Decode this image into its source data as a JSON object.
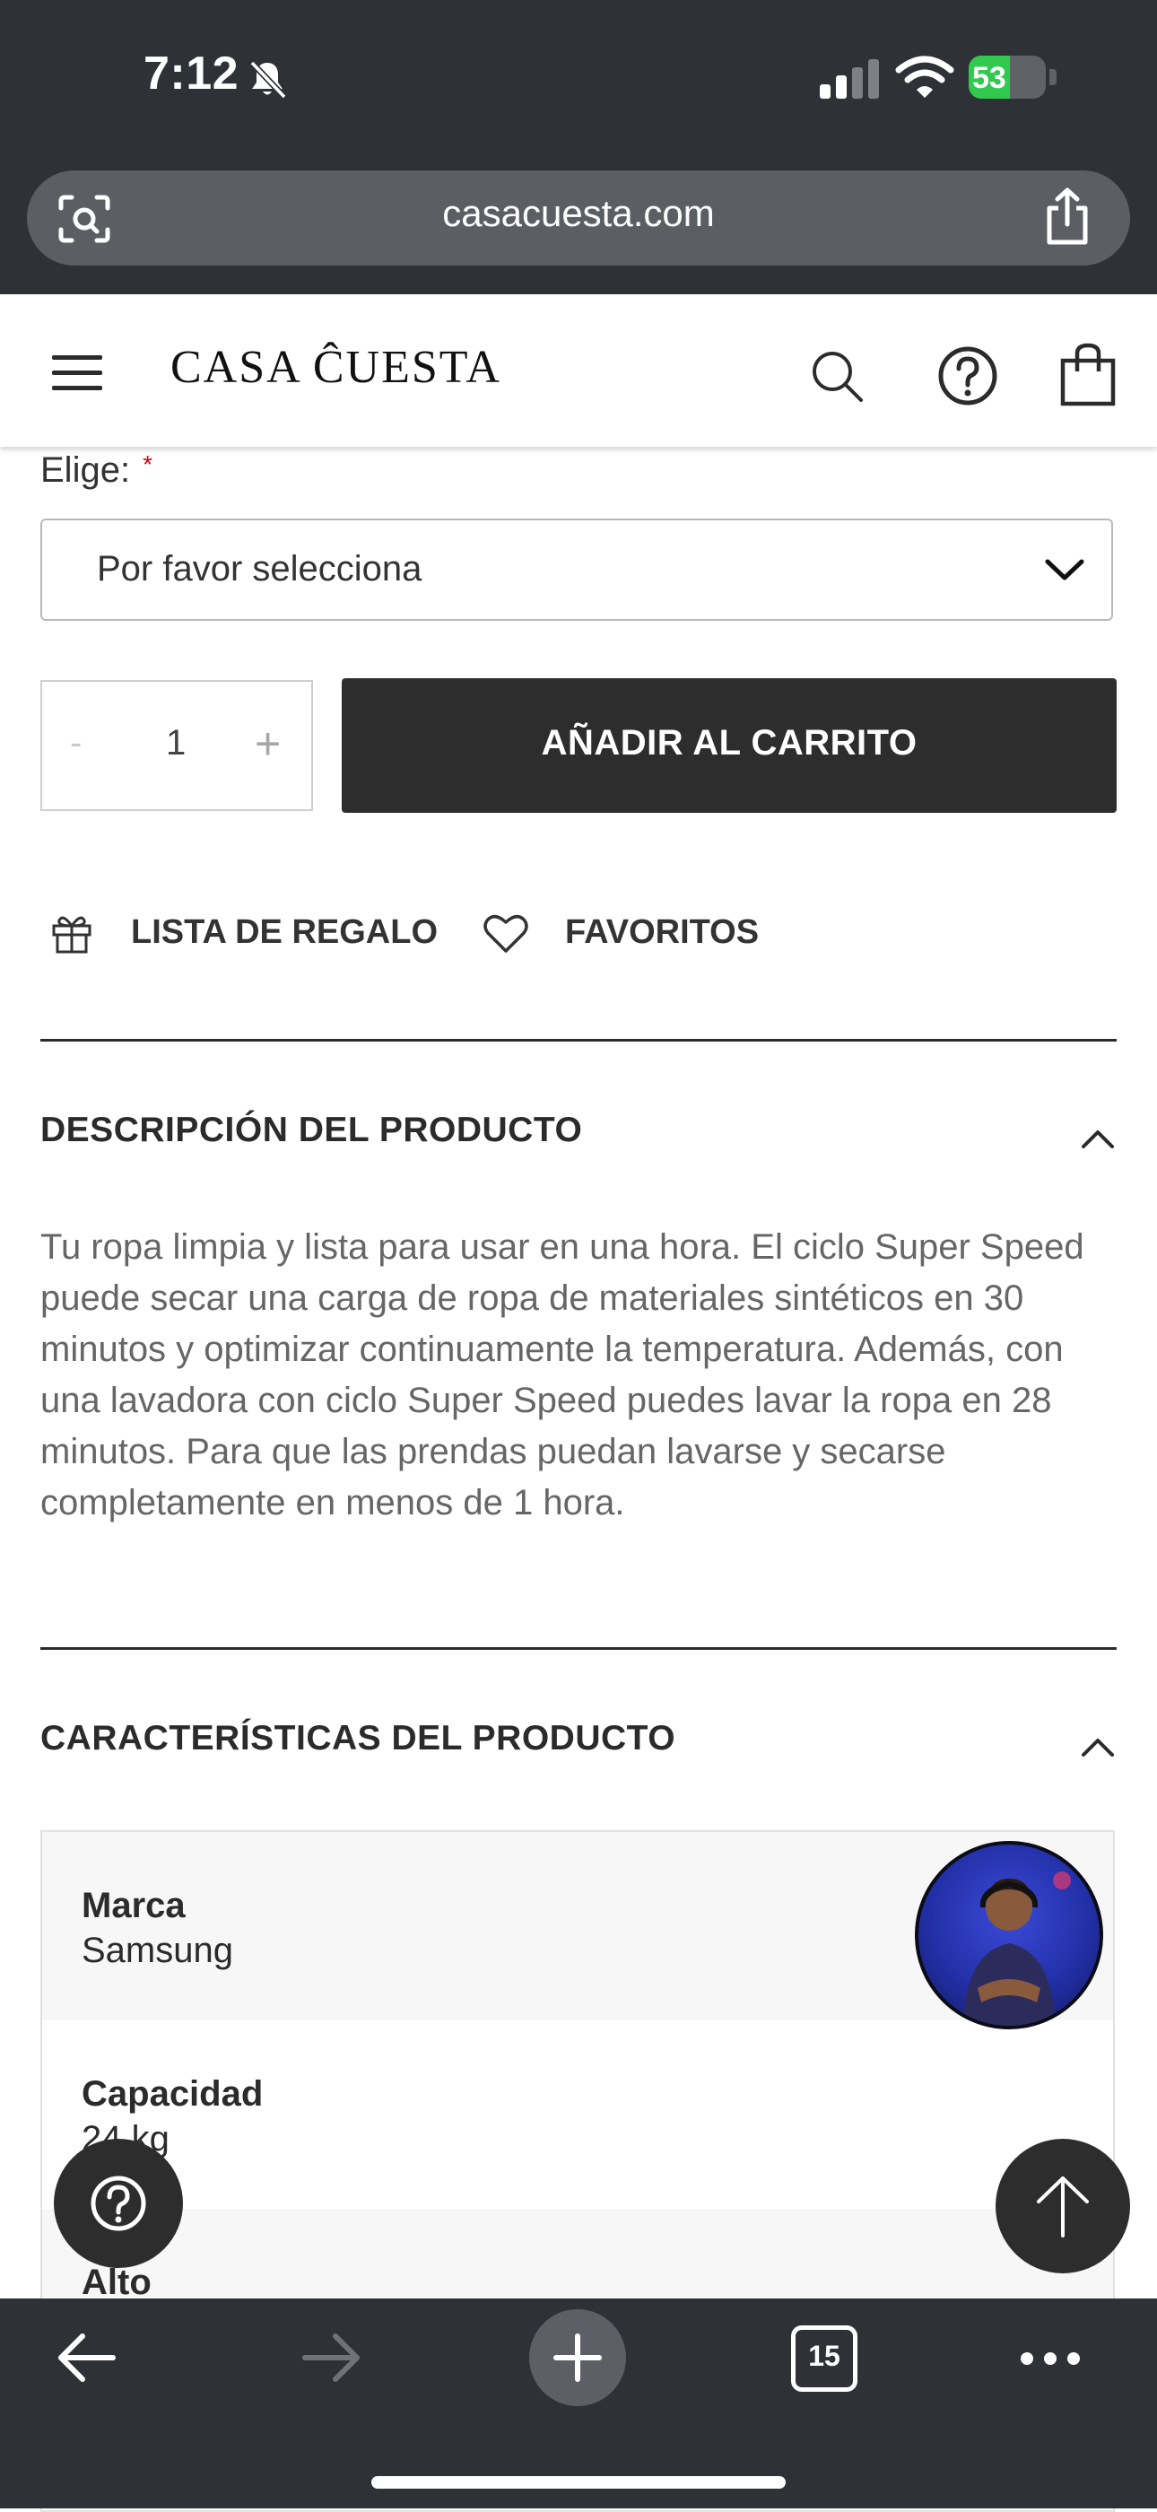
{
  "status_bar": {
    "time": "7:12",
    "battery": "53",
    "battery_level": 0.53
  },
  "browser": {
    "url": "casacuesta.com",
    "tab_count": "15"
  },
  "header": {
    "logo": "CASA ĈUESTA"
  },
  "form": {
    "choose_label": "Elige:",
    "required_mark": "*",
    "select_placeholder": "Por favor selecciona",
    "qty_minus": "-",
    "qty_value": "1",
    "qty_plus": "+",
    "add_to_cart": "AÑADIR AL CARRITO"
  },
  "actions": {
    "gift_list": "LISTA DE REGALO",
    "favorites": "FAVORITOS"
  },
  "description": {
    "title": "DESCRIPCIÓN DEL PRODUCTO",
    "text": "Tu ropa limpia y lista para usar en una hora. El ciclo Super Speed puede secar una carga de ropa de materiales sintéticos en 30 minutos y optimizar continuamente la temperatura. Además, con una lavadora con ciclo Super Speed puedes lavar la ropa en 28 minutos. Para que las prendas puedan lavarse y secarse completamente en menos de 1 hora."
  },
  "characteristics": {
    "title": "CARACTERÍSTICAS DEL PRODUCTO",
    "rows": [
      {
        "label": "Marca",
        "value": "Samsung"
      },
      {
        "label": "Capacidad",
        "value": "24 kg"
      },
      {
        "label": "Alto",
        "value": ""
      }
    ]
  },
  "icons": [
    "bell-slash-icon",
    "signal-icon",
    "wifi-icon",
    "battery-icon",
    "reader-icon",
    "share-icon",
    "menu-icon",
    "search-icon",
    "help-icon",
    "cart-icon",
    "chevron-down-icon",
    "gift-icon",
    "heart-icon",
    "chevron-up-icon",
    "arrow-up-icon",
    "back-icon",
    "forward-icon",
    "plus-icon",
    "more-icon"
  ],
  "colors": {
    "chrome": "#2e3135",
    "button_dark": "#2d2d2d",
    "battery_green": "#31c94f",
    "required": "#d0021b"
  }
}
